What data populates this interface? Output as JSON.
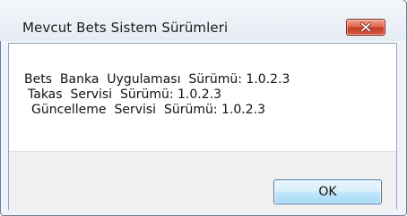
{
  "window": {
    "title": "Mevcut Bets Sistem Sürümleri",
    "close_icon": "close-x-icon"
  },
  "message": {
    "lines": [
      "Bets  Banka  Uygulaması  Sürümü: 1.0.2.3",
      "Takas  Servisi  Sürümü: 1.0.2.3",
      "Güncelleme  Servisi  Sürümü: 1.0.2.3"
    ]
  },
  "buttons": {
    "ok_label": "OK"
  },
  "colors": {
    "close_button": "#c9452c",
    "ok_button_border": "#3c7fb1",
    "footer_background": "#f0f0f0"
  }
}
